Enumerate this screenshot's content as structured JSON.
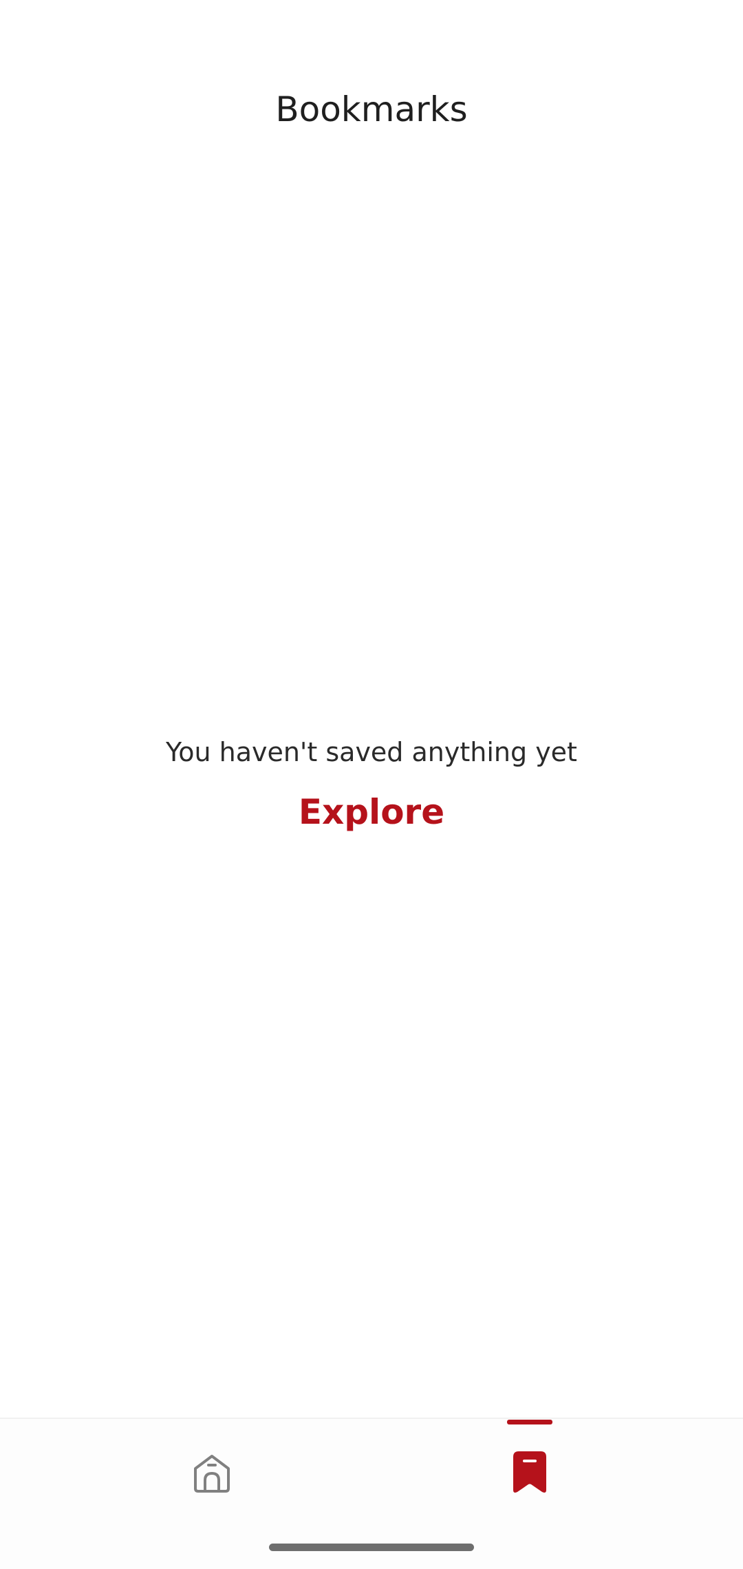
{
  "header": {
    "title": "Bookmarks"
  },
  "empty_state": {
    "message": "You haven't saved anything yet",
    "action_label": "Explore"
  },
  "bottom_nav": {
    "items": [
      {
        "icon": "home-icon",
        "active": false
      },
      {
        "icon": "bookmark-icon",
        "active": true
      }
    ]
  },
  "colors": {
    "accent": "#b5121b",
    "text": "#1f1f1f",
    "icon_inactive": "#808080",
    "background": "#ffffff"
  }
}
